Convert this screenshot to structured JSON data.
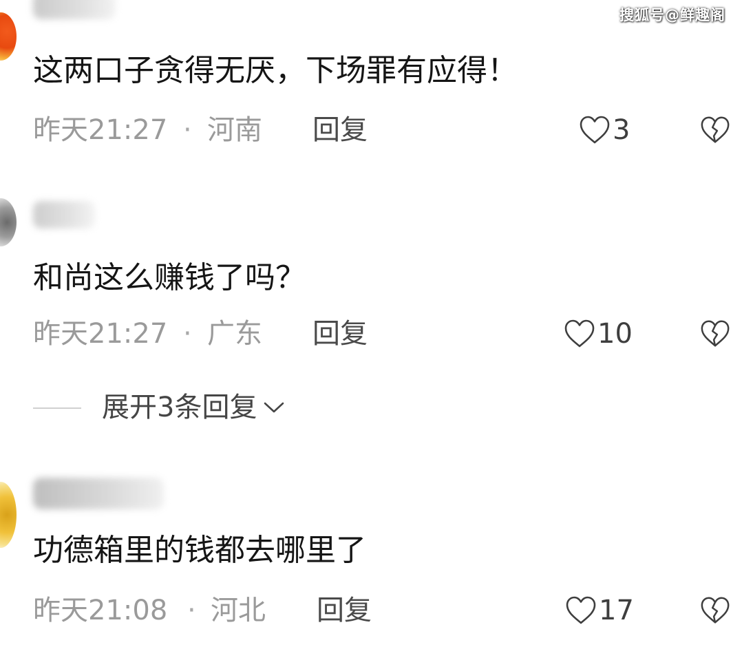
{
  "watermark": "搜狐号@鲜趣阁",
  "comments": [
    {
      "text": "这两口子贪得无厌，下场罪有应得！",
      "time": "昨天21:27",
      "separator": "·",
      "region": "河南",
      "reply_label": "回复",
      "likes": "3"
    },
    {
      "text": "和尚这么赚钱了吗？",
      "time": "昨天21:27",
      "separator": "·",
      "region": "广东",
      "reply_label": "回复",
      "likes": "10"
    },
    {
      "text": "功德箱里的钱都去哪里了",
      "time": "昨天21:08",
      "separator": "·",
      "region": "河北",
      "reply_label": "回复",
      "likes": "17"
    }
  ],
  "expand_replies": {
    "label": "展开3条回复"
  },
  "icons": {
    "like": "heart-outline-icon",
    "dislike": "broken-heart-icon",
    "expand": "chevron-down-icon"
  },
  "colors": {
    "text_primary": "#151515",
    "text_meta": "#9a9a9a",
    "icon": "#3e3e3e"
  }
}
